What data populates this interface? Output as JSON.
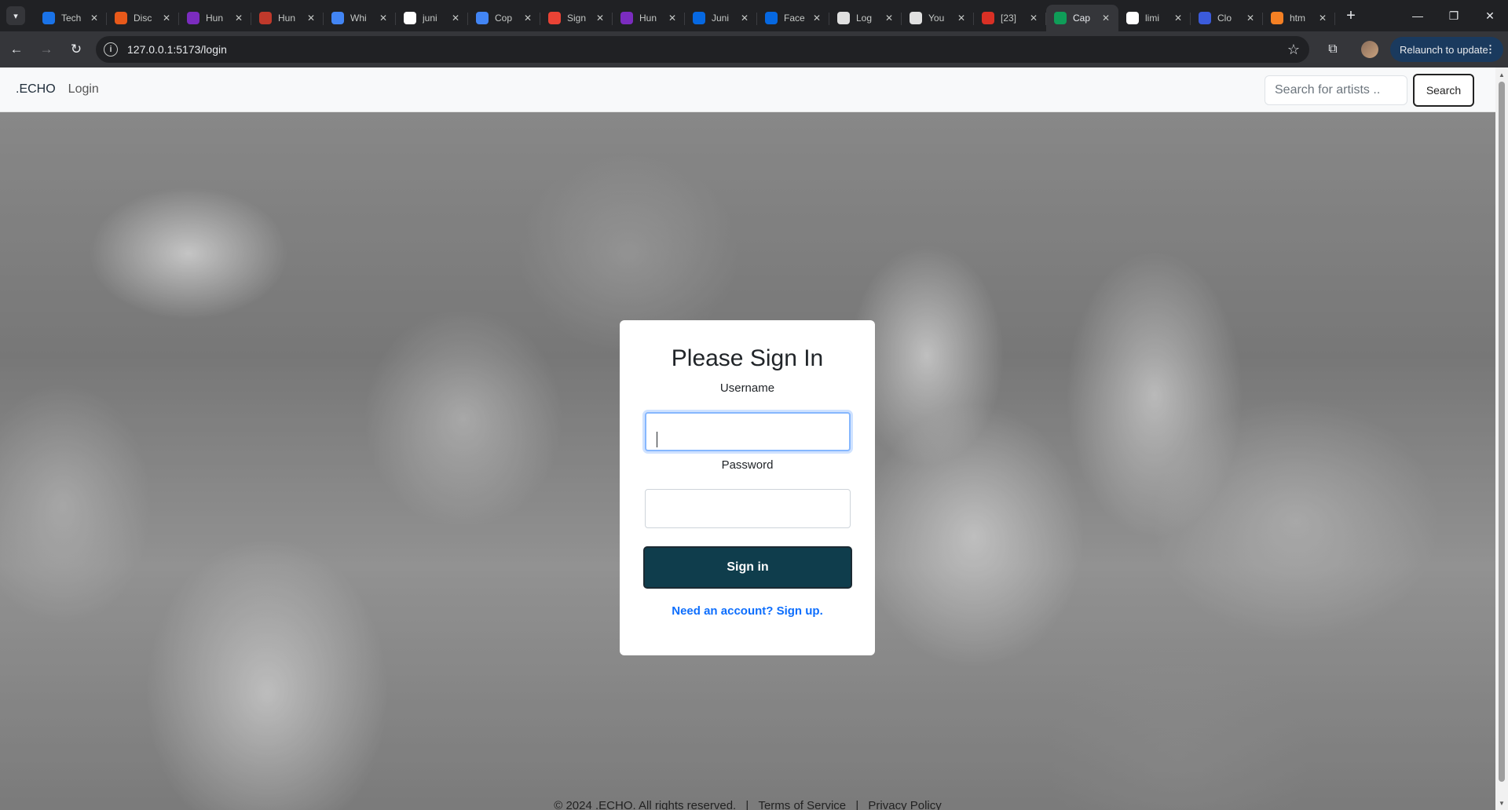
{
  "browser": {
    "tabs": [
      {
        "title": "Tech",
        "fav_color": "#1a73e8",
        "icon": "globe-icon"
      },
      {
        "title": "Disc",
        "fav_color": "#e8591a",
        "icon": "discourse-icon"
      },
      {
        "title": "Hun",
        "fav_color": "#7b2cbf",
        "icon": "hunter-icon"
      },
      {
        "title": "Hun",
        "fav_color": "#c0392b",
        "icon": "hunter-icon"
      },
      {
        "title": "Whi",
        "fav_color": "#4285f4",
        "icon": "docs-icon"
      },
      {
        "title": "juni",
        "fav_color": "#ffffff",
        "icon": "google-icon"
      },
      {
        "title": "Cop",
        "fav_color": "#4285f4",
        "icon": "docs-icon"
      },
      {
        "title": "Sign",
        "fav_color": "#ea4335",
        "icon": "gmail-icon"
      },
      {
        "title": "Hun",
        "fav_color": "#7b2cbf",
        "icon": "hunter-icon"
      },
      {
        "title": "Juni",
        "fav_color": "#0668e1",
        "icon": "meta-icon"
      },
      {
        "title": "Face",
        "fav_color": "#0668e1",
        "icon": "meta-icon"
      },
      {
        "title": "Log",
        "fav_color": "#e0e0e0",
        "icon": "globe-icon"
      },
      {
        "title": "You",
        "fav_color": "#e0e0e0",
        "icon": "globe-icon"
      },
      {
        "title": "[23]",
        "fav_color": "#d93025",
        "icon": "mail-icon"
      },
      {
        "title": "Cap",
        "fav_color": "#0f9d58",
        "icon": "v-icon",
        "active": true
      },
      {
        "title": "limi",
        "fav_color": "#ffffff",
        "icon": "google-icon"
      },
      {
        "title": "Clo",
        "fav_color": "#3b5bdb",
        "icon": "cloud-icon"
      },
      {
        "title": "htm",
        "fav_color": "#f48024",
        "icon": "stackoverflow-icon"
      }
    ],
    "url": "127.0.0.1:5173/login",
    "relaunch_label": "Relaunch to update"
  },
  "site": {
    "brand": ".ECHO",
    "nav_login": "Login",
    "search_placeholder": "Search for artists ..",
    "search_button": "Search"
  },
  "login": {
    "title": "Please Sign In",
    "username_label": "Username",
    "username_value": "",
    "password_label": "Password",
    "password_value": "",
    "submit_label": "Sign in",
    "signup_link": "Need an account? Sign up."
  },
  "footer": {
    "copyright": "© 2024 .ECHO. All rights reserved.",
    "separator": "|",
    "terms": "Terms of Service",
    "privacy": "Privacy Policy"
  },
  "colors": {
    "primary_button": "#0f3d4c",
    "link": "#0d6efd",
    "chrome_dark": "#202124",
    "chrome_toolbar": "#35363a"
  }
}
